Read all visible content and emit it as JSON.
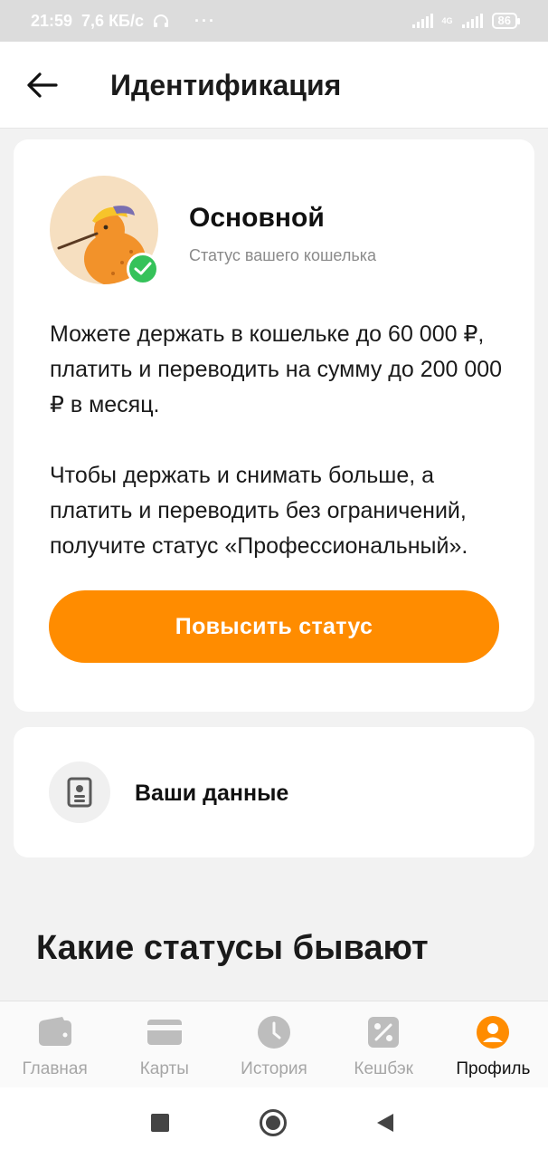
{
  "status_bar": {
    "time": "21:59",
    "speed": "7,6 КБ/с",
    "dots": "···",
    "network": "4G",
    "battery": "86"
  },
  "header": {
    "title": "Идентификация"
  },
  "status_card": {
    "status_name": "Основной",
    "status_sub": "Статус вашего кошелька",
    "paragraph_1": "Можете держать в кошельке до 60 000 ₽, платить и переводить на сумму до 200 000 ₽ в месяц.",
    "paragraph_2": "Чтобы держать и снимать больше, а платить и переводить без ограничений, получите статус «Профессиональный».",
    "upgrade_button": "Повысить статус"
  },
  "data_card": {
    "label": "Ваши данные"
  },
  "section_title": "Какие статусы бывают",
  "bottom_nav": {
    "items": [
      {
        "label": "Главная",
        "icon": "wallet-icon"
      },
      {
        "label": "Карты",
        "icon": "card-icon"
      },
      {
        "label": "История",
        "icon": "clock-icon"
      },
      {
        "label": "Кешбэк",
        "icon": "percent-icon"
      },
      {
        "label": "Профиль",
        "icon": "profile-icon"
      }
    ],
    "active_index": 4
  },
  "colors": {
    "accent": "#ff8c00",
    "success": "#35c25a",
    "inactive": "#bdbdbd"
  }
}
